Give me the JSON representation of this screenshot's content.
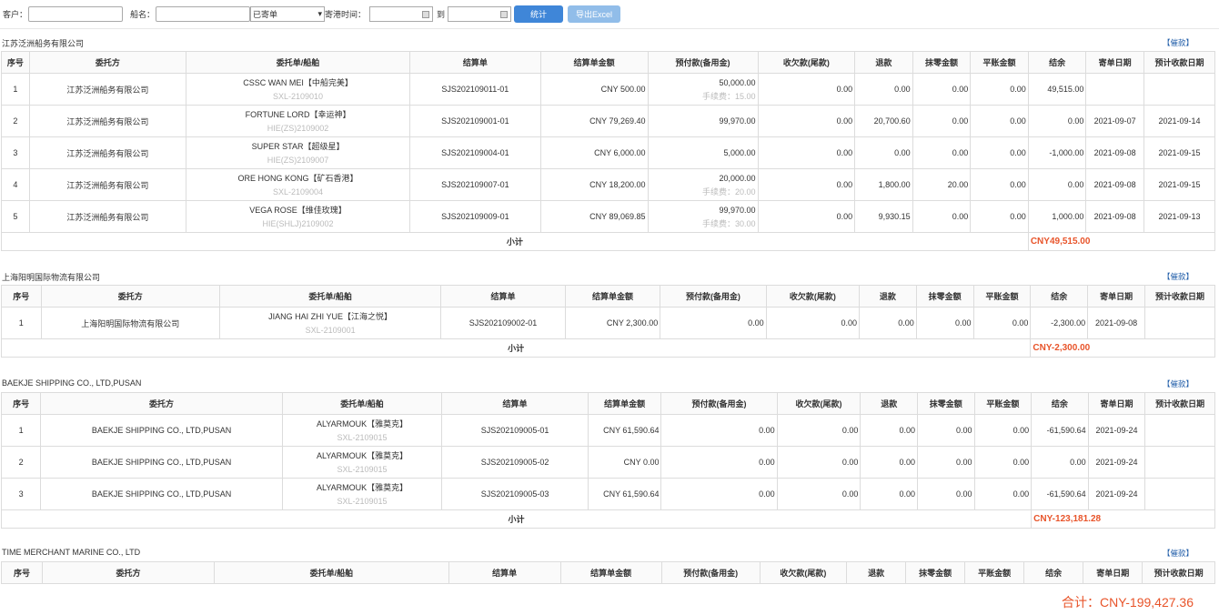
{
  "toolbar": {
    "customer_label": "客户：",
    "ship_label": "船名：",
    "status_value": "已寄单",
    "date_label": "寄港时间：",
    "to_label": "到",
    "stat_button": "统计",
    "export_button": "导出Excel"
  },
  "headers": [
    "序号",
    "委托方",
    "委托单/船舶",
    "结算单",
    "结算单金额",
    "预付款(备用金)",
    "收欠款(尾款)",
    "退款",
    "抹零金额",
    "平账金额",
    "结余",
    "寄单日期",
    "预计收款日期"
  ],
  "remind_label": "【催款】",
  "subtotal_label": "小计",
  "groups": [
    {
      "title": "江苏泛洲船务有限公司",
      "subtotal": "CNY49,515.00",
      "rows": [
        {
          "no": "1",
          "client": "江苏泛洲船务有限公司",
          "ship": "CSSC WAN MEI【中船完美】",
          "order": "SXL-2109010",
          "bill": "SJS202109011-01",
          "amount": "CNY 500.00",
          "prepay": "50,000.00",
          "fee": "手续费：15.00",
          "owed": "0.00",
          "refund": "0.00",
          "round": "0.00",
          "flat": "0.00",
          "balance": "49,515.00",
          "send_date": "",
          "due_date": ""
        },
        {
          "no": "2",
          "client": "江苏泛洲船务有限公司",
          "ship": "FORTUNE LORD【幸运神】",
          "order": "HIE(ZS)2109002",
          "bill": "SJS202109001-01",
          "amount": "CNY 79,269.40",
          "prepay": "99,970.00",
          "fee": "",
          "owed": "0.00",
          "refund": "20,700.60",
          "round": "0.00",
          "flat": "0.00",
          "balance": "0.00",
          "send_date": "2021-09-07",
          "due_date": "2021-09-14"
        },
        {
          "no": "3",
          "client": "江苏泛洲船务有限公司",
          "ship": "SUPER STAR【超级星】",
          "order": "HIE(ZS)2109007",
          "bill": "SJS202109004-01",
          "amount": "CNY 6,000.00",
          "prepay": "5,000.00",
          "fee": "",
          "owed": "0.00",
          "refund": "0.00",
          "round": "0.00",
          "flat": "0.00",
          "balance": "-1,000.00",
          "send_date": "2021-09-08",
          "due_date": "2021-09-15"
        },
        {
          "no": "4",
          "client": "江苏泛洲船务有限公司",
          "ship": "ORE HONG KONG【矿石香港】",
          "order": "SXL-2109004",
          "bill": "SJS202109007-01",
          "amount": "CNY 18,200.00",
          "prepay": "20,000.00",
          "fee": "手续费：20.00",
          "owed": "0.00",
          "refund": "1,800.00",
          "round": "20.00",
          "flat": "0.00",
          "balance": "0.00",
          "send_date": "2021-09-08",
          "due_date": "2021-09-15"
        },
        {
          "no": "5",
          "client": "江苏泛洲船务有限公司",
          "ship": "VEGA ROSE【维佳玫瑰】",
          "order": "HIE(SHLJ)2109002",
          "bill": "SJS202109009-01",
          "amount": "CNY 89,069.85",
          "prepay": "99,970.00",
          "fee": "手续费：30.00",
          "owed": "0.00",
          "refund": "9,930.15",
          "round": "0.00",
          "flat": "0.00",
          "balance": "1,000.00",
          "send_date": "2021-09-08",
          "due_date": "2021-09-13"
        }
      ]
    },
    {
      "title": "上海阳明国际物流有限公司",
      "subtotal": "CNY-2,300.00",
      "rows": [
        {
          "no": "1",
          "client": "上海阳明国际物流有限公司",
          "ship": "JIANG HAI ZHI YUE【江海之悦】",
          "order": "SXL-2109001",
          "bill": "SJS202109002-01",
          "amount": "CNY 2,300.00",
          "prepay": "0.00",
          "fee": "",
          "owed": "0.00",
          "refund": "0.00",
          "round": "0.00",
          "flat": "0.00",
          "balance": "-2,300.00",
          "send_date": "2021-09-08",
          "due_date": ""
        }
      ]
    },
    {
      "title": "BAEKJE SHIPPING CO., LTD,PUSAN",
      "subtotal": "CNY-123,181.28",
      "rows": [
        {
          "no": "1",
          "client": "BAEKJE SHIPPING CO., LTD,PUSAN",
          "ship": "ALYARMOUK【雅莫克】",
          "order": "SXL-2109015",
          "bill": "SJS202109005-01",
          "amount": "CNY 61,590.64",
          "prepay": "0.00",
          "fee": "",
          "owed": "0.00",
          "refund": "0.00",
          "round": "0.00",
          "flat": "0.00",
          "balance": "-61,590.64",
          "send_date": "2021-09-24",
          "due_date": ""
        },
        {
          "no": "2",
          "client": "BAEKJE SHIPPING CO., LTD,PUSAN",
          "ship": "ALYARMOUK【雅莫克】",
          "order": "SXL-2109015",
          "bill": "SJS202109005-02",
          "amount": "CNY 0.00",
          "prepay": "0.00",
          "fee": "",
          "owed": "0.00",
          "refund": "0.00",
          "round": "0.00",
          "flat": "0.00",
          "balance": "0.00",
          "send_date": "2021-09-24",
          "due_date": ""
        },
        {
          "no": "3",
          "client": "BAEKJE SHIPPING CO., LTD,PUSAN",
          "ship": "ALYARMOUK【雅莫克】",
          "order": "SXL-2109015",
          "bill": "SJS202109005-03",
          "amount": "CNY 61,590.64",
          "prepay": "0.00",
          "fee": "",
          "owed": "0.00",
          "refund": "0.00",
          "round": "0.00",
          "flat": "0.00",
          "balance": "-61,590.64",
          "send_date": "2021-09-24",
          "due_date": ""
        }
      ]
    },
    {
      "title": "TIME MERCHANT MARINE CO., LTD",
      "subtotal": "",
      "rows": []
    }
  ],
  "total": "合计：CNY-199,427.36"
}
